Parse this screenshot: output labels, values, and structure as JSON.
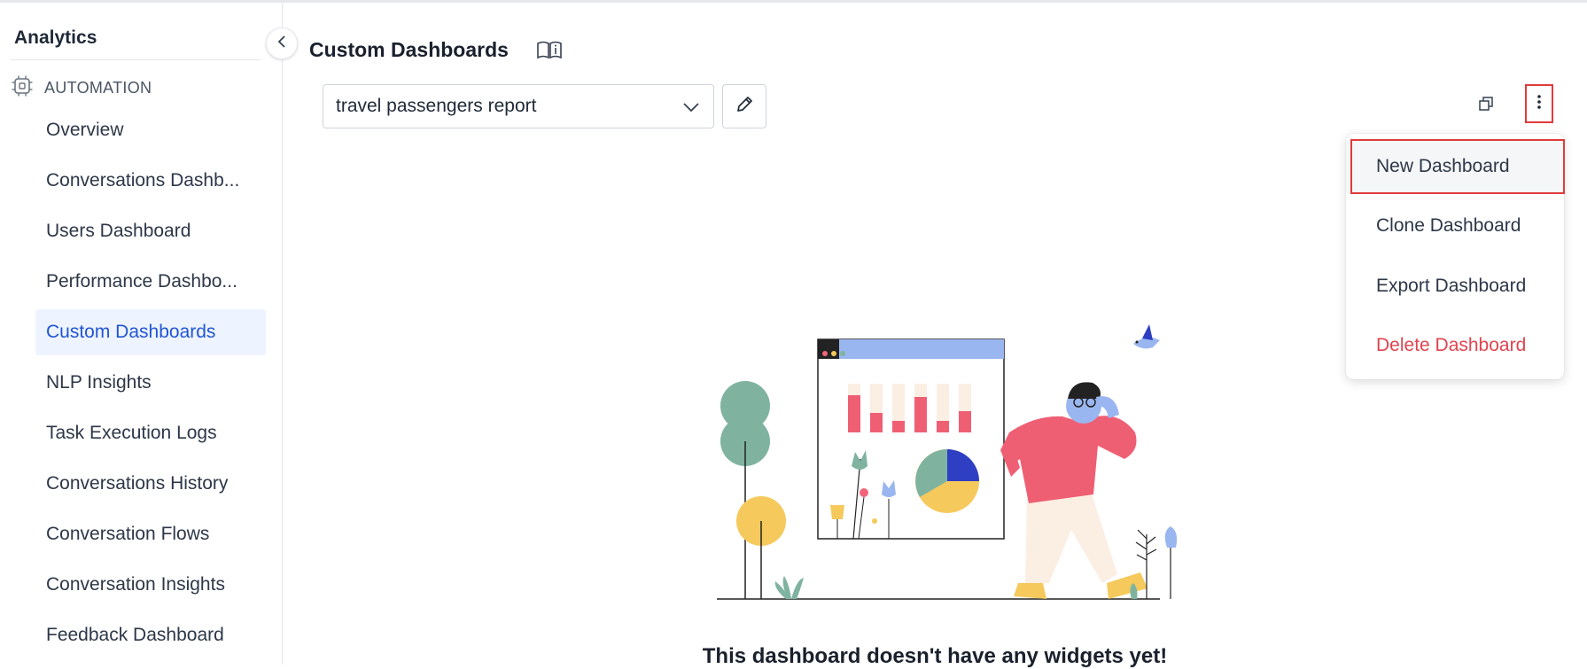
{
  "sidebar": {
    "title": "Analytics",
    "section_label": "AUTOMATION",
    "section_icon": "chip-icon",
    "items": [
      {
        "label": "Overview"
      },
      {
        "label": "Conversations Dashb..."
      },
      {
        "label": "Users Dashboard"
      },
      {
        "label": "Performance Dashbo..."
      },
      {
        "label": "Custom Dashboards",
        "active": true
      },
      {
        "label": "NLP Insights"
      },
      {
        "label": "Task Execution Logs"
      },
      {
        "label": "Conversations History"
      },
      {
        "label": "Conversation Flows"
      },
      {
        "label": "Conversation Insights"
      },
      {
        "label": "Feedback Dashboard"
      }
    ]
  },
  "header": {
    "title": "Custom Dashboards",
    "doc_icon": "book-info-icon"
  },
  "toolbar": {
    "selected_dashboard": "travel passengers report"
  },
  "menu": {
    "items": [
      {
        "label": "New Dashboard"
      },
      {
        "label": "Clone Dashboard"
      },
      {
        "label": "Export Dashboard"
      },
      {
        "label": "Delete Dashboard"
      }
    ]
  },
  "empty_state": {
    "message": "This dashboard doesn't have any widgets yet!"
  },
  "colors": {
    "accent": "#2155d4",
    "active_bg": "#eef4ff",
    "danger": "#e0444f",
    "highlight_border": "#e03b3b"
  }
}
